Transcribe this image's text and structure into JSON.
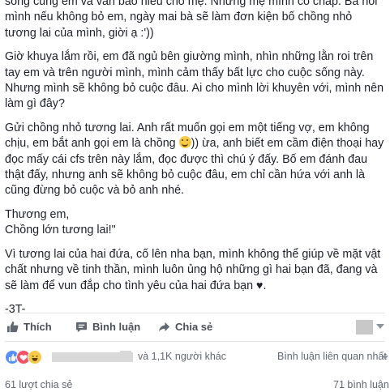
{
  "post": {
    "paragraphs": [
      "sống cùng em và vẫn báo hiếu cho mẹ. Nhưng mẹ mình cố chấp. Bà nói mình nếu không bỏ em, ngày mai bà sẽ làm đơn kiện bố chồng nhỏ tương lai của mình, giời ạ :'))",
      "Giờ khuya lắm rồi, em đã ngủ bên giường mình, nhìn những lằn roi trên tay em và trên người mình, mình cảm thấy bất lực cho cuộc sống này. Nhưng mình sẽ không bỏ cuộc đâu. Ai cho mình lời khuyên với, mình nên làm gì đây?",
      "Gửi chồng nhỏ tương lai. Anh rất muốn gọi em một tiếng vợ, em không chịu, em bắt anh gọi em là chồng",
      ")) ừa, anh biết em cầm điện thoại hay đọc mấy cái cfs trên này lắm, đọc được thì chú ý đấy. Bố em đánh đau thật đấy, nhưng anh sẽ không bỏ cuộc đâu, em chỉ cần hứa với anh là cũng đừng bỏ cuộc và bỏ anh nhé.",
      "Thương em,",
      "Chồng lớn tương lai!\"",
      "Vì tương lai của hai đứa, cố lên nha bạn, mình không thể giúp về mặt vật chất nhưng về tinh thần, mình luôn ủng hộ những gì hai bạn đã, đang và sẽ làm để vun đắp cho tình yêu của hai đứa bạn ♥.",
      "-3T-"
    ]
  },
  "actions": {
    "like": "Thích",
    "comment": "Bình luận",
    "share": "Chia sẻ"
  },
  "reactions": {
    "others": "và 1,1K người khác",
    "relevant": "Bình luận liên quan nhất"
  },
  "footer": {
    "shares": "61 lượt chia sẻ",
    "comments": "71 bình luận"
  },
  "colors": {
    "like_blue": "#5890ff",
    "love_red": "#f25268",
    "haha_yellow": "#f7c948"
  }
}
